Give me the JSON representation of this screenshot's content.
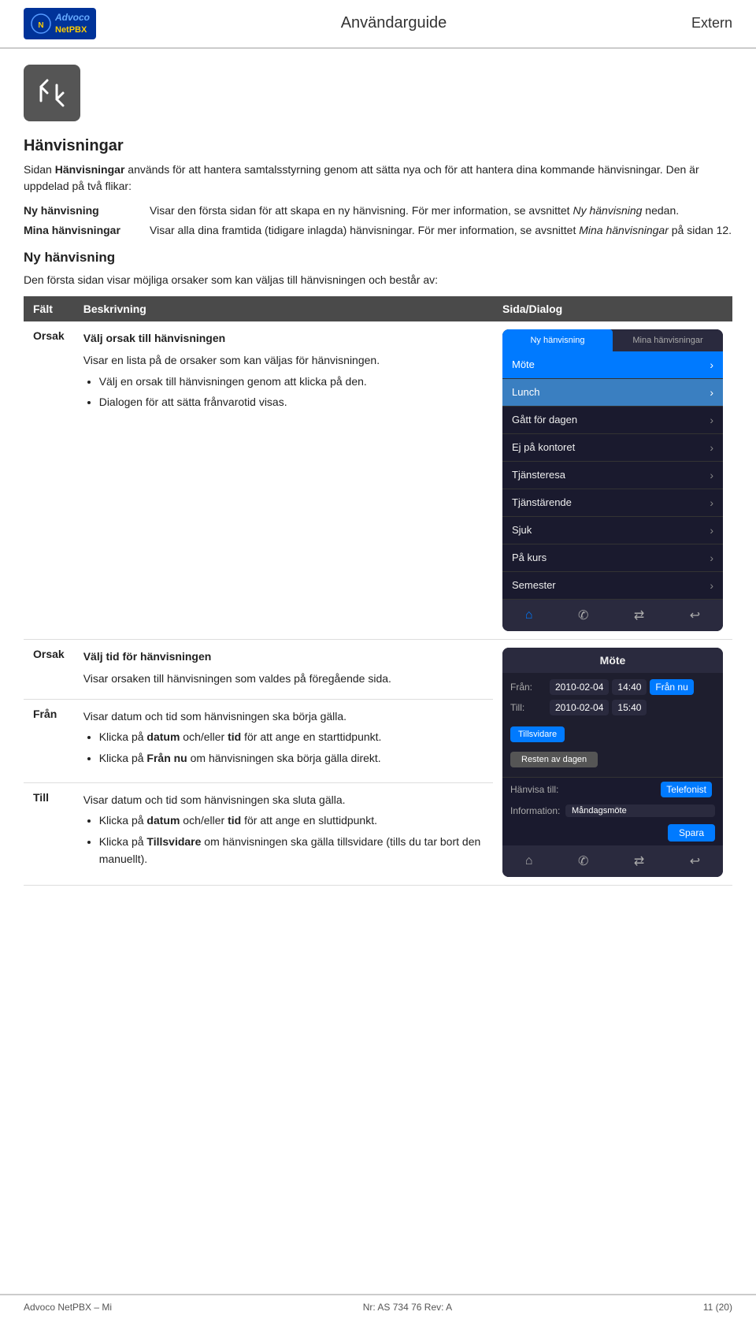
{
  "header": {
    "logo_line1": "Advoco",
    "logo_line2": "NetPBX",
    "title": "Användarguide",
    "extern": "Extern"
  },
  "icon": {
    "alt": "Hänvisningar icon"
  },
  "page": {
    "section_title": "Hänvisningar",
    "intro1": "Sidan ",
    "intro1_bold": "Hänvisningar",
    "intro1_rest": " används för att hantera samtalsstyrning genom att sätta nya och för att hantera dina kommande hänvisningar. Den är uppdelad på två flikar:",
    "def1_term": "Ny hänvisning",
    "def1_desc_pre": "Visar den första sidan för att skapa en ny hänvisning. För mer information, se avsnittet ",
    "def1_desc_em": "Ny hänvisning",
    "def1_desc_post": " nedan.",
    "def2_term": "Mina hänvisningar",
    "def2_desc_pre": "Visar alla dina framtida (tidigare inlagda) hänvisningar. För mer information, se avsnittet ",
    "def2_desc_em": "Mina hänvisningar",
    "def2_desc_post": " på sidan 12.",
    "subsection1_title": "Ny hänvisning",
    "subsection1_intro": "Den första sidan visar möjliga orsaker som kan väljas till hänvisningen och består av:",
    "table_header_falt": "Fält",
    "table_header_beskrivning": "Beskrivning",
    "table_header_sida": "Sida/Dialog",
    "row1_term": "Orsak",
    "row1_sub": "Välj orsak till hänvisningen",
    "row1_desc1": "Visar en lista på de orsaker som kan väljas för hänvisningen.",
    "row1_bullet1": "Välj en orsak till hänvisningen genom att klicka på den.",
    "row1_bullet2": "Dialogen för att sätta frånvarotid visas.",
    "phone1_tab1": "Ny hänvisning",
    "phone1_tab2": "Mina hänvisningar",
    "phone1_items": [
      {
        "label": "Möte",
        "highlighted": true
      },
      {
        "label": "Lunch",
        "highlighted": false
      },
      {
        "label": "Gått för dagen",
        "highlighted": false
      },
      {
        "label": "Ej på kontoret",
        "highlighted": false
      },
      {
        "label": "Tjänsteresa",
        "highlighted": false
      },
      {
        "label": "Tjänstärende",
        "highlighted": false
      },
      {
        "label": "Sjuk",
        "highlighted": false
      },
      {
        "label": "På kurs",
        "highlighted": false
      },
      {
        "label": "Semester",
        "highlighted": false
      }
    ],
    "section2_row2_term": "Orsak",
    "section2_row2_sub": "Välj tid för hänvisningen",
    "section2_row2_desc": "Visar orsaken till hänvisningen som valdes på föregående sida.",
    "section2_row3_term": "Från",
    "section2_row3_desc": "Visar datum och tid som hänvisningen ska börja gälla.",
    "section2_row3_b1_pre": "Klicka på ",
    "section2_row3_b1_bold": "datum",
    "section2_row3_b1_mid": " och/eller ",
    "section2_row3_b1_bold2": "tid",
    "section2_row3_b1_post": " för att ange en starttidpunkt.",
    "section2_row3_b2_pre": "Klicka på ",
    "section2_row3_b2_bold": "Från nu",
    "section2_row3_b2_post": " om hänvisningen ska börja gälla direkt.",
    "section2_row4_term": "Till",
    "section2_row4_desc": "Visar datum och tid som hänvisningen ska sluta gälla.",
    "section2_row4_b1_pre": "Klicka på ",
    "section2_row4_b1_bold": "datum",
    "section2_row4_b1_mid": " och/eller ",
    "section2_row4_b1_bold2": "tid",
    "section2_row4_b1_post": " för att ange en sluttidpunkt.",
    "section2_row4_b2_pre": "Klicka på ",
    "section2_row4_b2_bold": "Tillsvidare",
    "section2_row4_b2_post": " om hänvisningen ska gälla tillsvidare (tills du tar bort den manuellt).",
    "phone2_title": "Möte",
    "phone2_fran_label": "Från:",
    "phone2_fran_date": "2010-02-04",
    "phone2_fran_time": "14:40",
    "phone2_fran_now": "Från nu",
    "phone2_till_label": "Till:",
    "phone2_till_date": "2010-02-04",
    "phone2_till_time": "15:40",
    "phone2_tillsvidare": "Tillsvidare",
    "phone2_resten": "Resten av dagen",
    "phone2_hanvisa_label": "Hänvisa till:",
    "phone2_hanvisa_value": "Telefonist",
    "phone2_info_label": "Information:",
    "phone2_info_value": "Måndagsmöte",
    "phone2_spara": "Spara"
  },
  "footer": {
    "left": "Advoco NetPBX – Mi",
    "center": "Nr: AS 734 76 Rev: A",
    "right": "11 (20)"
  }
}
